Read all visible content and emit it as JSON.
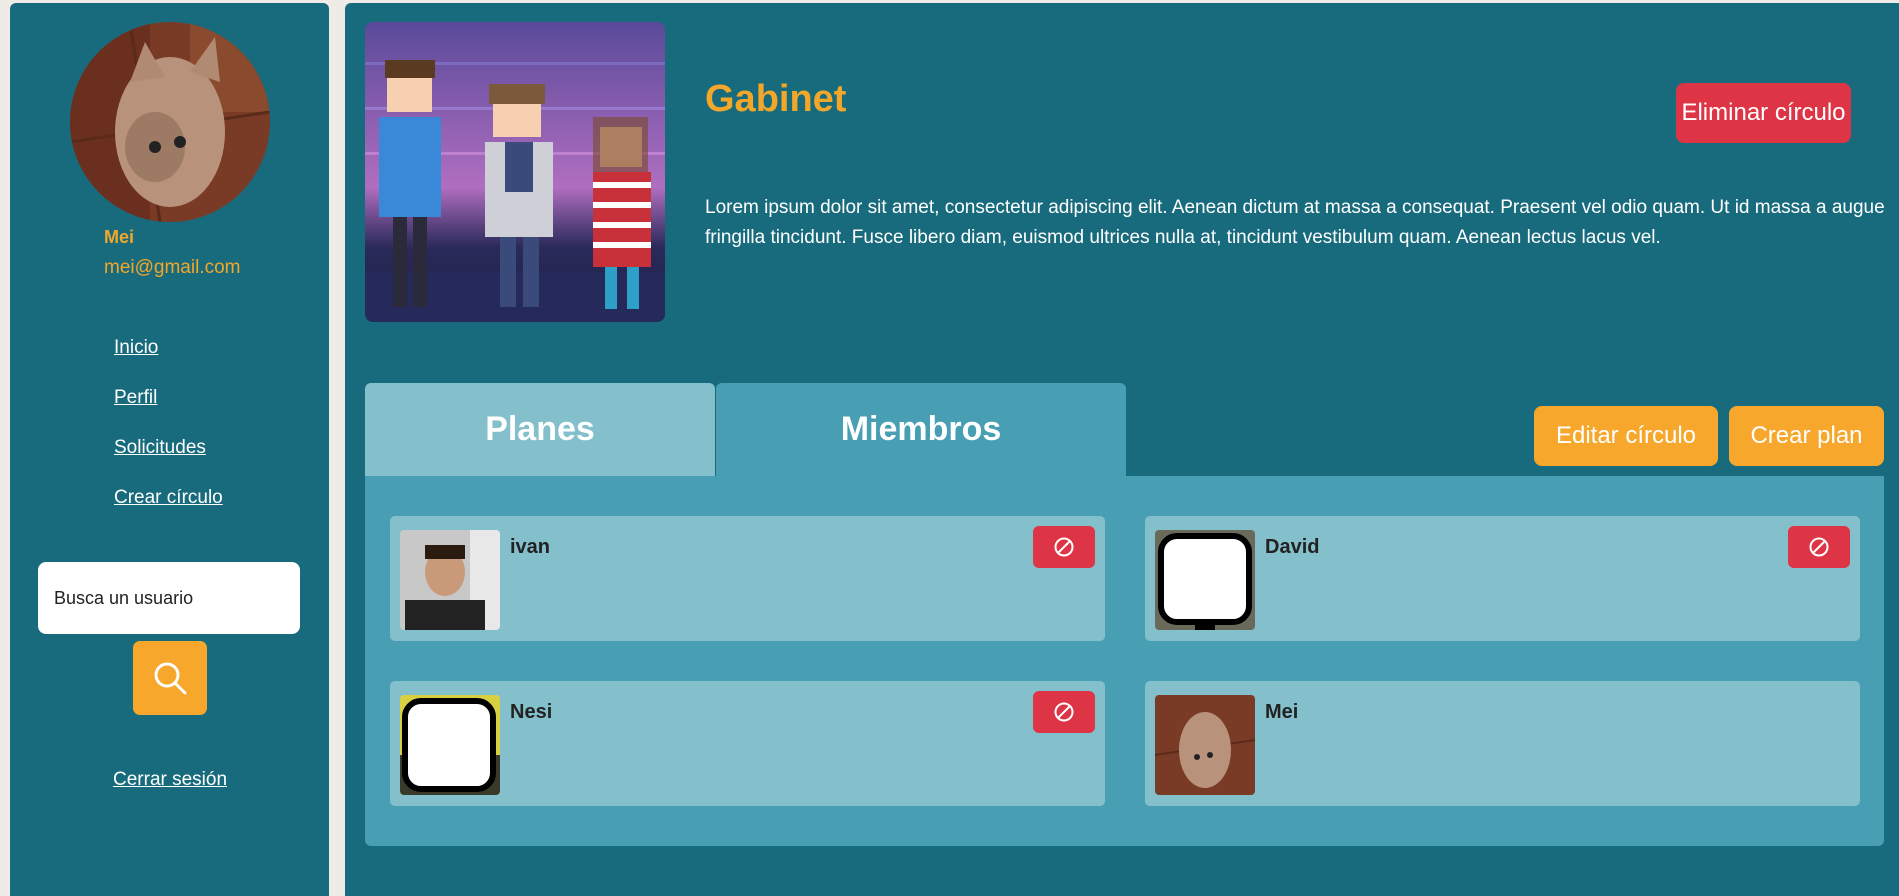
{
  "sidebar": {
    "user_name": "Mei",
    "user_email": "mei@gmail.com",
    "nav": [
      {
        "label": "Inicio"
      },
      {
        "label": "Perfil"
      },
      {
        "label": "Solicitudes"
      },
      {
        "label": "Crear círculo"
      }
    ],
    "search": {
      "placeholder": "Busca un usuario",
      "icon": "search-icon"
    },
    "logout_label": "Cerrar sesión"
  },
  "circle": {
    "title": "Gabinet",
    "description": "Lorem ipsum dolor sit amet, consectetur adipiscing elit. Aenean dictum at massa a consequat. Praesent vel odio quam. Ut id massa a augue fringilla tincidunt. Fusce libero diam, euismod ultrices nulla at, tincidunt vestibulum quam. Aenean lectus lacus vel.",
    "delete_label": "Eliminar círculo"
  },
  "tabs": [
    {
      "label": "Planes"
    },
    {
      "label": "Miembros",
      "active": true
    }
  ],
  "actions": {
    "edit_label": "Editar círculo",
    "create_plan_label": "Crear plan"
  },
  "members": [
    {
      "name": "ivan",
      "removable": true
    },
    {
      "name": "David",
      "removable": true
    },
    {
      "name": "Nesi",
      "removable": true
    },
    {
      "name": "Mei",
      "removable": false
    }
  ],
  "colors": {
    "teal_dark": "#186b7d",
    "teal_mid": "#489fb4",
    "teal_light": "#84c0cb",
    "accent_orange": "#f6a72c",
    "danger_red": "#dd3545"
  }
}
